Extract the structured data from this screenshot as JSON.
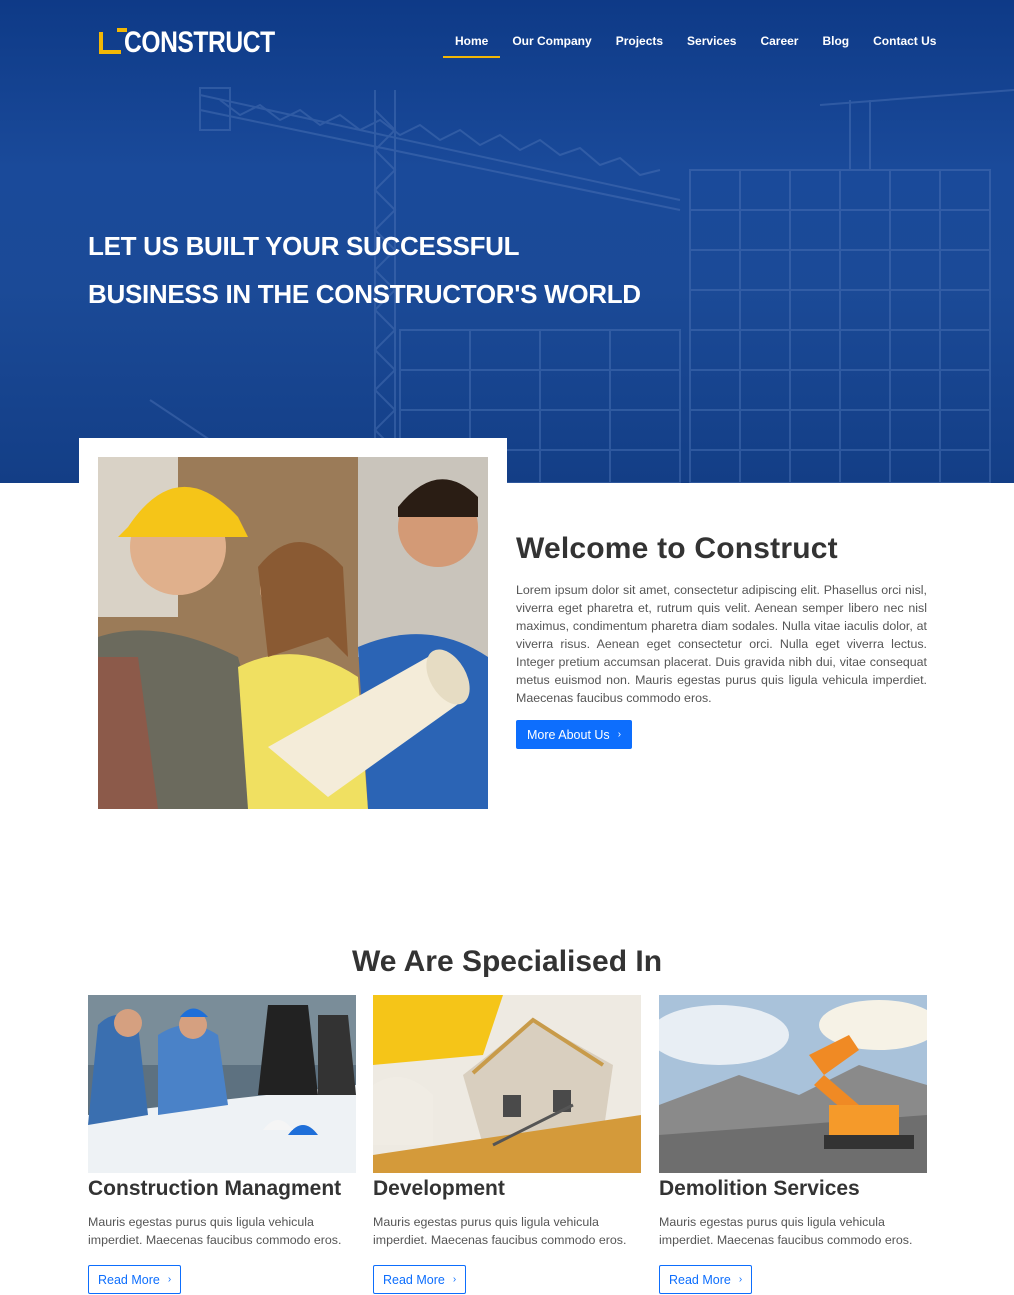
{
  "brand": {
    "name": "CONSTRUCT"
  },
  "nav": {
    "items": [
      {
        "label": "Home",
        "active": true
      },
      {
        "label": "Our Company"
      },
      {
        "label": "Projects"
      },
      {
        "label": "Services"
      },
      {
        "label": "Career"
      },
      {
        "label": "Blog"
      },
      {
        "label": "Contact Us"
      }
    ]
  },
  "hero": {
    "line1": "LET US BUILT YOUR SUCCESSFUL",
    "line2": "BUSINESS IN THE CONSTRUCTOR'S WORLD"
  },
  "about": {
    "title": "Welcome to Construct",
    "text": "Lorem ipsum dolor sit amet, consectetur adipiscing elit. Phasellus orci nisl, viverra eget pharetra et, rutrum quis velit. Aenean semper libero nec nisl maximus, condimentum pharetra diam sodales. Nulla vitae iaculis dolor, at viverra risus. Aenean eget consectetur orci. Nulla eget viverra lectus. Integer pretium accumsan placerat. Duis gravida nibh dui, vitae consequat metus euismod non. Mauris egestas purus quis ligula vehicula imperdiet. Maecenas faucibus commodo eros.",
    "button": "More About Us"
  },
  "specialised": {
    "title": "We Are Specialised In",
    "cards": [
      {
        "title": "Construction Managment",
        "text": "Mauris egestas purus quis ligula vehicula imperdiet. Maecenas faucibus commodo eros.",
        "button": "Read More"
      },
      {
        "title": "Development",
        "text": "Mauris egestas purus quis ligula vehicula imperdiet. Maecenas faucibus commodo eros.",
        "button": "Read More"
      },
      {
        "title": "Demolition Services",
        "text": "Mauris egestas purus quis ligula vehicula imperdiet. Maecenas faucibus commodo eros.",
        "button": "Read More"
      }
    ]
  },
  "colors": {
    "primary": "#0d6efd",
    "accent": "#f2b705",
    "hero": "#1a4a9a"
  },
  "icons": {
    "chevron": "chevron-right-icon"
  }
}
